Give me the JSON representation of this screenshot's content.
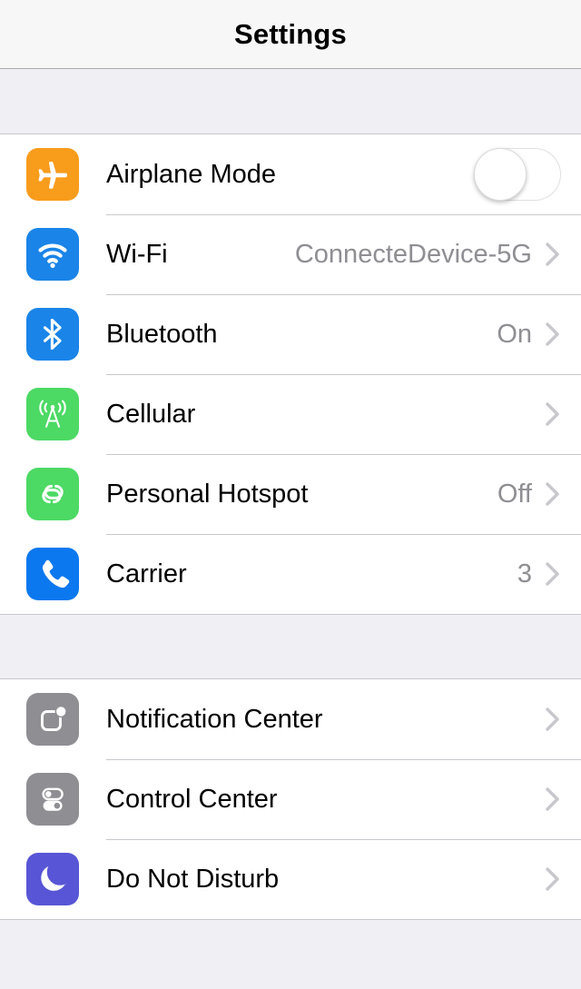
{
  "navbar": {
    "title": "Settings"
  },
  "colors": {
    "airplane_orange": "#f89c1c",
    "wifi_blue": "#1a84e8",
    "bluetooth_blue": "#1a84e8",
    "cellular_green": "#4cd964",
    "hotspot_green": "#4cd964",
    "carrier_blue": "#0b78ef",
    "notification_gray": "#8e8e93",
    "control_gray": "#8e8e93",
    "dnd_purple": "#5856d6",
    "separator": "#c8c7cc",
    "group_background": "#efeff4",
    "value_text": "#8e8e93",
    "label_text": "#000000"
  },
  "sections": [
    {
      "name": "connectivity",
      "rows": [
        {
          "label": "Airplane Mode",
          "icon": "airplane-icon",
          "icon_color": "#f89c1c",
          "accessory": "switch",
          "switch_on": false,
          "value": ""
        },
        {
          "label": "Wi-Fi",
          "icon": "wifi-icon",
          "icon_color": "#1a84e8",
          "accessory": "chevron",
          "value": "ConnecteDevice-5G"
        },
        {
          "label": "Bluetooth",
          "icon": "bluetooth-icon",
          "icon_color": "#1a84e8",
          "accessory": "chevron",
          "value": "On"
        },
        {
          "label": "Cellular",
          "icon": "cellular-icon",
          "icon_color": "#4cd964",
          "accessory": "chevron",
          "value": ""
        },
        {
          "label": "Personal Hotspot",
          "icon": "hotspot-icon",
          "icon_color": "#4cd964",
          "accessory": "chevron",
          "value": "Off"
        },
        {
          "label": "Carrier",
          "icon": "phone-icon",
          "icon_color": "#0b78ef",
          "accessory": "chevron",
          "value": "3"
        }
      ]
    },
    {
      "name": "notifications",
      "rows": [
        {
          "label": "Notification Center",
          "icon": "notification-center-icon",
          "icon_color": "#8e8e93",
          "accessory": "chevron",
          "value": ""
        },
        {
          "label": "Control Center",
          "icon": "control-center-icon",
          "icon_color": "#8e8e93",
          "accessory": "chevron",
          "value": ""
        },
        {
          "label": "Do Not Disturb",
          "icon": "moon-icon",
          "icon_color": "#5856d6",
          "accessory": "chevron",
          "value": ""
        }
      ]
    }
  ]
}
